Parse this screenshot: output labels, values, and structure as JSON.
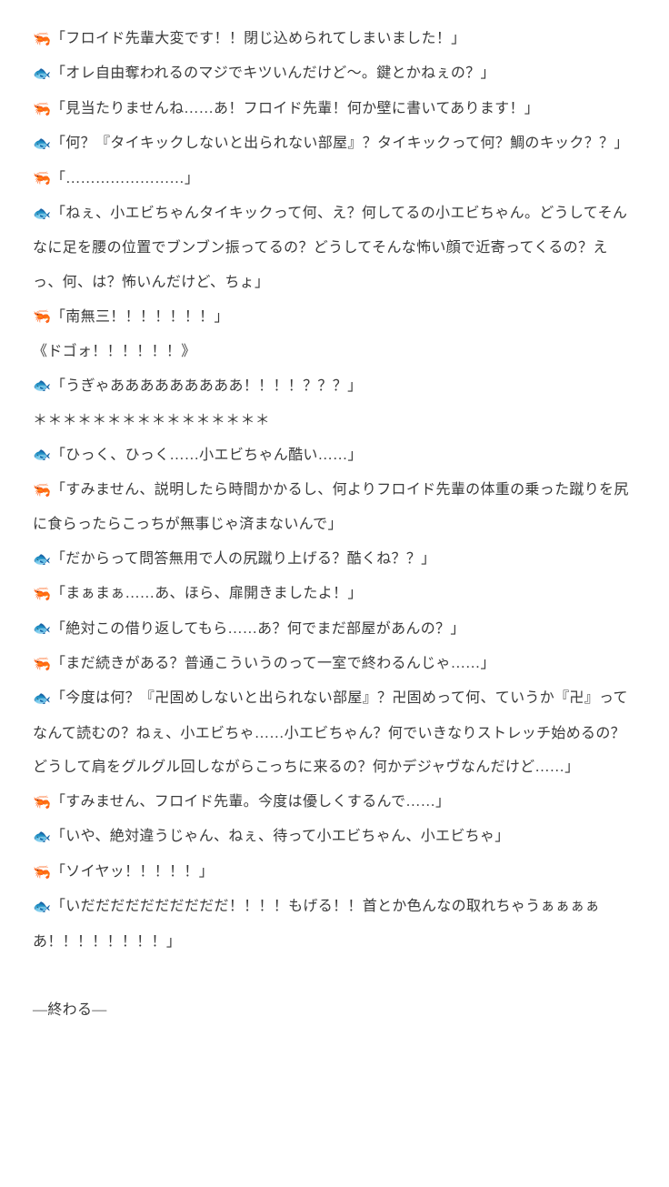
{
  "icons": {
    "shrimp": "🦐",
    "fish": "🐟"
  },
  "lines": [
    {
      "icon": "shrimp",
      "text": "「フロイド先輩大変です！！閉じ込められてしまいました！」"
    },
    {
      "icon": "fish",
      "text": "「オレ自由奪われるのマジでキツいんだけど〜。鍵とかねぇの？」"
    },
    {
      "icon": "shrimp",
      "text": "「見当たりませんね……あ！フロイド先輩！何か壁に書いてあります！」"
    },
    {
      "icon": "fish",
      "text": "「何？『タイキックしないと出られない部屋』？タイキックって何？鯛のキック？？」"
    },
    {
      "icon": "shrimp",
      "text": "「……………………」"
    },
    {
      "icon": "fish",
      "text": "「ねぇ、小エビちゃんタイキックって何、え？何してるの小エビちゃん。どうしてそんなに足を腰の位置でブンブン振ってるの？どうしてそんな怖い顔で近寄ってくるの？えっ、何、は？怖いんだけど、ちょ」"
    },
    {
      "icon": "shrimp",
      "text": "「南無三！！！！！！！」"
    },
    {
      "icon": null,
      "text": "《ドゴォ！！！！！！》"
    },
    {
      "icon": "fish",
      "text": "「うぎゃあああああああああ！！！！？？？」"
    },
    {
      "icon": null,
      "text": "＊＊＊＊＊＊＊＊＊＊＊＊＊＊＊＊"
    },
    {
      "icon": "fish",
      "text": "「ひっく、ひっく……小エビちゃん酷い……」"
    },
    {
      "icon": "shrimp",
      "text": "「すみません、説明したら時間かかるし、何よりフロイド先輩の体重の乗った蹴りを尻に食らったらこっちが無事じゃ済まないんで」"
    },
    {
      "icon": "fish",
      "text": "「だからって問答無用で人の尻蹴り上げる？酷くね？？」"
    },
    {
      "icon": "shrimp",
      "text": "「まぁまぁ……あ、ほら、扉開きましたよ！」"
    },
    {
      "icon": "fish",
      "text": "「絶対この借り返してもら……あ？何でまだ部屋があんの？」"
    },
    {
      "icon": "shrimp",
      "text": "「まだ続きがある？普通こういうのって一室で終わるんじゃ……」"
    },
    {
      "icon": "fish",
      "text": "「今度は何？『卍固めしないと出られない部屋』？卍固めって何、ていうか『卍』ってなんて読むの？ねぇ、小エビちゃ……小エビちゃん？何でいきなりストレッチ始めるの？どうして肩をグルグル回しながらこっちに来るの？何かデジャヴなんだけど……」"
    },
    {
      "icon": "shrimp",
      "text": "「すみません、フロイド先輩。今度は優しくするんで……」"
    },
    {
      "icon": "fish",
      "text": "「いや、絶対違うじゃん、ねぇ、待って小エビちゃん、小エビちゃ」"
    },
    {
      "icon": "shrimp",
      "text": "「ソイヤッ！！！！！」"
    },
    {
      "icon": "fish",
      "text": "「いだだだだだだだだだだ！！！！もげる！！首とか色んなの取れちゃうぁぁぁぁあ！！！！！！！！」"
    }
  ],
  "ending": "―終わる―"
}
